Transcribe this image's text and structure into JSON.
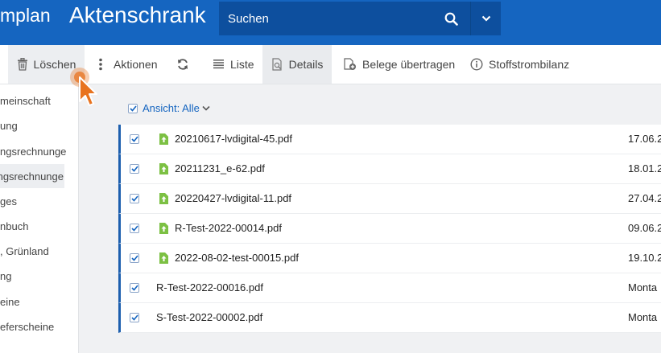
{
  "header": {
    "app_name": "mplan",
    "page_title": "Aktenschrank",
    "search": {
      "placeholder": "Suchen",
      "value": ""
    }
  },
  "toolbar": {
    "delete": "Löschen",
    "actions": "Aktionen",
    "list": "Liste",
    "details": "Details",
    "transfer": "Belege übertragen",
    "balance": "Stoffstrombilanz"
  },
  "sidebar": {
    "items": [
      "meinschaft",
      "ung",
      "ngsrechnunge",
      "ngsrechnunge",
      "ges",
      "nbuch",
      ", Grünland",
      "ng",
      "eine",
      "eferscheine"
    ],
    "active_index": 3
  },
  "view": {
    "label": "Ansicht: Alle"
  },
  "files": [
    {
      "name": "20210617-lvdigital-45.pdf",
      "date": "17.06.2",
      "icon": "file-upload-icon"
    },
    {
      "name": "20211231_e-62.pdf",
      "date": "18.01.2",
      "icon": "file-upload-icon"
    },
    {
      "name": "20220427-lvdigital-11.pdf",
      "date": "27.04.2",
      "icon": "file-upload-icon"
    },
    {
      "name": "R-Test-2022-00014.pdf",
      "date": "09.06.2",
      "icon": "file-upload-icon"
    },
    {
      "name": "2022-08-02-test-00015.pdf",
      "date": "19.10.2",
      "icon": "file-upload-icon"
    },
    {
      "name": "R-Test-2022-00016.pdf",
      "date": "Monta",
      "icon": ""
    },
    {
      "name": "S-Test-2022-00002.pdf",
      "date": "Monta",
      "icon": ""
    }
  ],
  "colors": {
    "primary": "#1565c0",
    "search_bg": "#0d4f9e",
    "file_icon": "#7cc043",
    "cursor": "#e8731f"
  }
}
